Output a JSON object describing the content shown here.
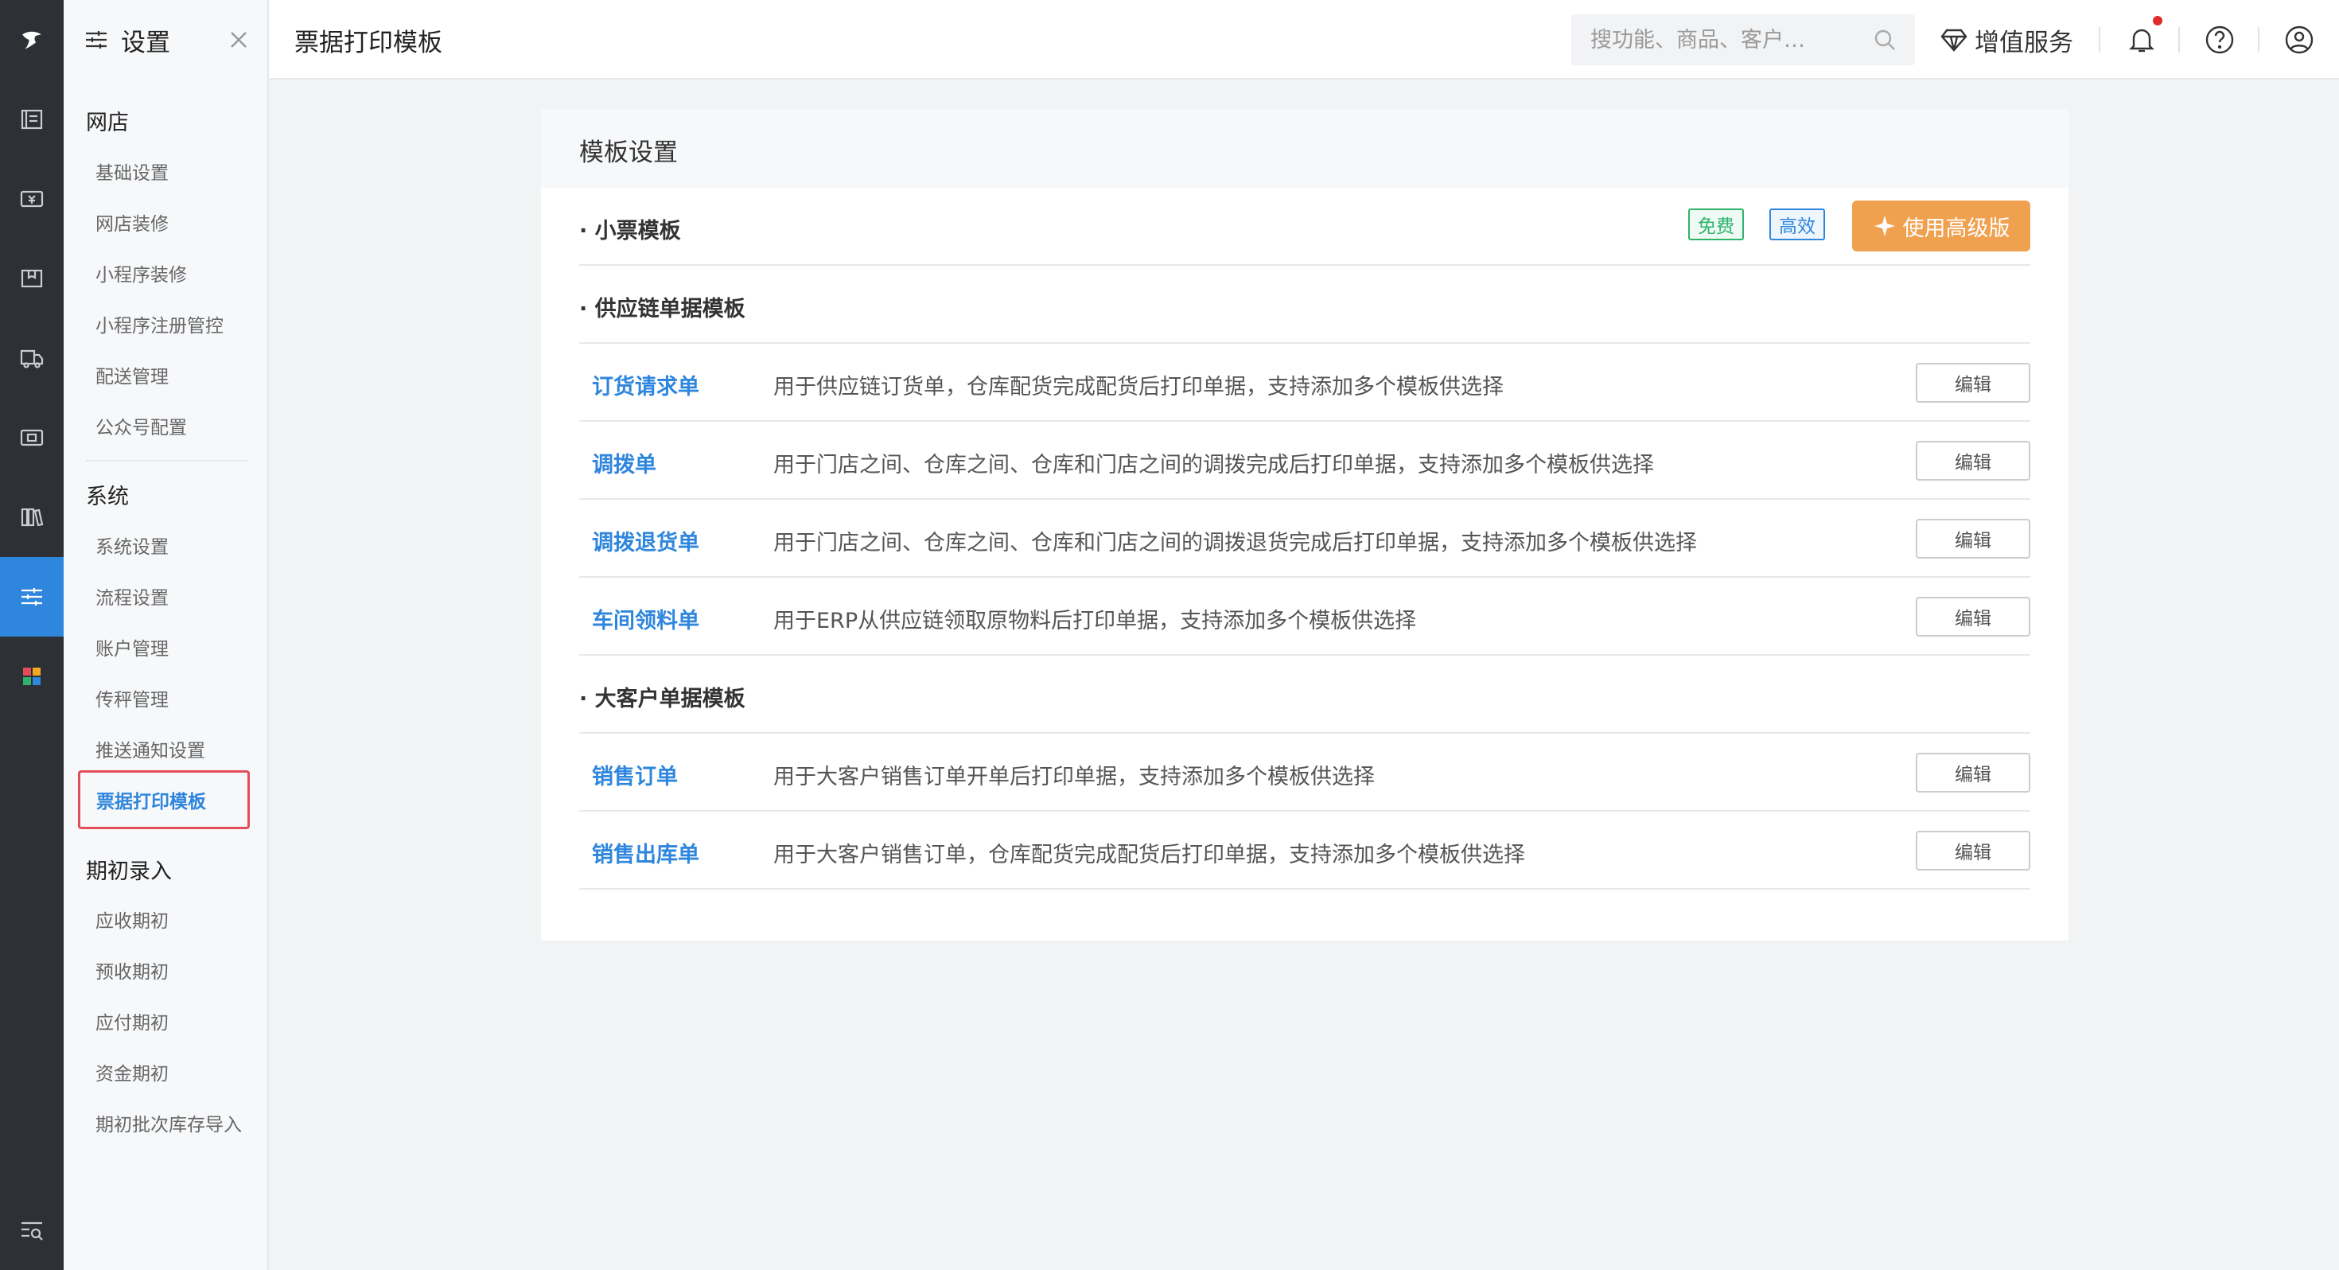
{
  "rail": {
    "icons": [
      "logo-icon",
      "report-icon",
      "cash-icon",
      "package-icon",
      "truck-icon",
      "card-icon",
      "books-icon",
      "settings-sliders-icon",
      "apps-grid-icon",
      "search-list-icon"
    ],
    "active_color": "#2f86dd"
  },
  "sidebar": {
    "title": "设置",
    "groups": [
      {
        "label": "网店",
        "items": [
          "基础设置",
          "网店装修",
          "小程序装修",
          "小程序注册管控",
          "配送管理",
          "公众号配置"
        ]
      },
      {
        "label": "系统",
        "items": [
          "系统设置",
          "流程设置",
          "账户管理",
          "传秤管理",
          "推送通知设置",
          "票据打印模板"
        ]
      },
      {
        "label": "期初录入",
        "items": [
          "应收期初",
          "预收期初",
          "应付期初",
          "资金期初",
          "期初批次库存导入"
        ]
      }
    ],
    "selected": "票据打印模板"
  },
  "header": {
    "title": "票据打印模板",
    "search_placeholder": "搜功能、商品、客户…",
    "value_service": "增值服务"
  },
  "card": {
    "title": "模板设置",
    "receipt_section": "小票模板",
    "badge_free": "免费",
    "badge_efficient": "高效",
    "pro_button": "使用高级版",
    "supply_section": "供应链单据模板",
    "supply_rows": [
      {
        "name": "订货请求单",
        "desc": "用于供应链订货单，仓库配货完成配货后打印单据，支持添加多个模板供选择",
        "action": "编辑"
      },
      {
        "name": "调拨单",
        "desc": "用于门店之间、仓库之间、仓库和门店之间的调拨完成后打印单据，支持添加多个模板供选择",
        "action": "编辑"
      },
      {
        "name": "调拨退货单",
        "desc": "用于门店之间、仓库之间、仓库和门店之间的调拨退货完成后打印单据，支持添加多个模板供选择",
        "action": "编辑"
      },
      {
        "name": "车间领料单",
        "desc": "用于ERP从供应链领取原物料后打印单据，支持添加多个模板供选择",
        "action": "编辑"
      }
    ],
    "customer_section": "大客户单据模板",
    "customer_rows": [
      {
        "name": "销售订单",
        "desc": "用于大客户销售订单开单后打印单据，支持添加多个模板供选择",
        "action": "编辑"
      },
      {
        "name": "销售出库单",
        "desc": "用于大客户销售订单，仓库配货完成配货后打印单据，支持添加多个模板供选择",
        "action": "编辑"
      }
    ]
  }
}
